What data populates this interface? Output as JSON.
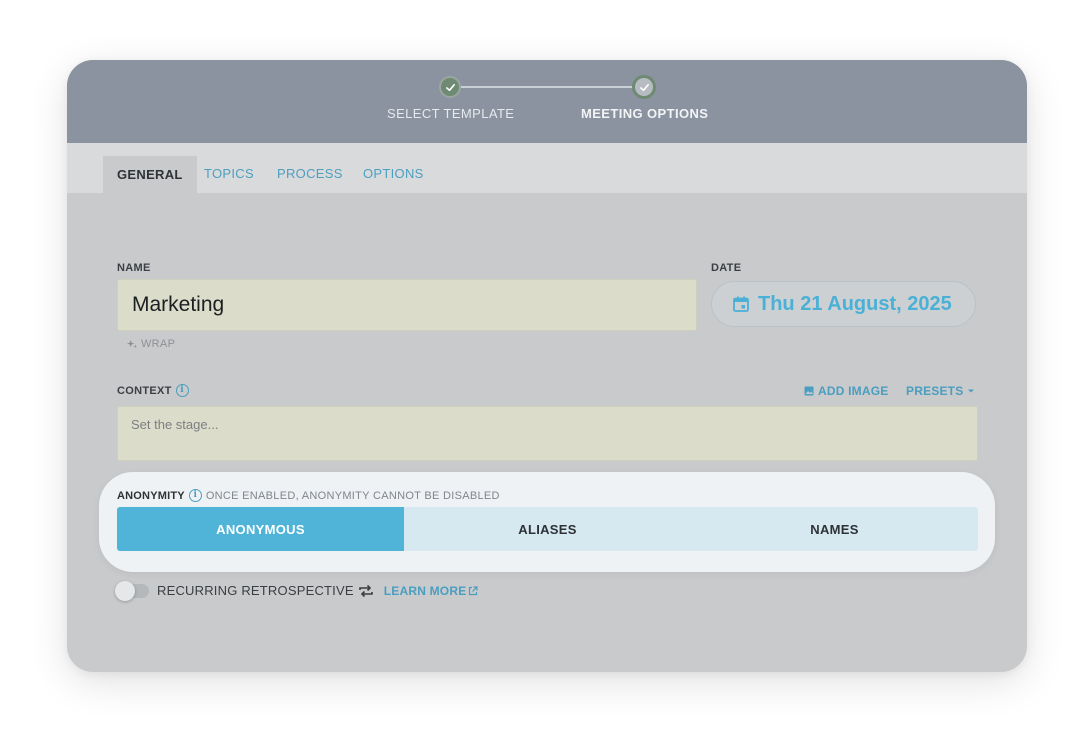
{
  "stepper": {
    "steps": [
      {
        "label": "SELECT TEMPLATE",
        "status": "complete"
      },
      {
        "label": "MEETING OPTIONS",
        "status": "current"
      }
    ]
  },
  "tabs": [
    {
      "label": "GENERAL",
      "active": true
    },
    {
      "label": "TOPICS",
      "active": false
    },
    {
      "label": "PROCESS",
      "active": false
    },
    {
      "label": "OPTIONS",
      "active": false
    }
  ],
  "form": {
    "name": {
      "label": "NAME",
      "value": "Marketing",
      "wrap_hint": "WRAP"
    },
    "date": {
      "label": "DATE",
      "value": "Thu 21 August, 2025",
      "icon": "calendar-icon"
    },
    "context": {
      "label": "CONTEXT",
      "placeholder": "Set the stage...",
      "add_image_label": "ADD IMAGE",
      "presets_label": "PRESETS"
    },
    "anonymity": {
      "label": "ANONYMITY",
      "warning": "ONCE ENABLED, ANONYMITY CANNOT BE DISABLED",
      "options": [
        "ANONYMOUS",
        "ALIASES",
        "NAMES"
      ],
      "selected": "ANONYMOUS"
    },
    "recurring": {
      "label": "RECURRING RETROSPECTIVE",
      "enabled": false,
      "learn_more_label": "LEARN MORE"
    }
  },
  "colors": {
    "accent": "#4fb4d8",
    "link": "#4a9ec0",
    "stepper_bg": "#8a939f",
    "input_bg": "#dcdcca"
  }
}
